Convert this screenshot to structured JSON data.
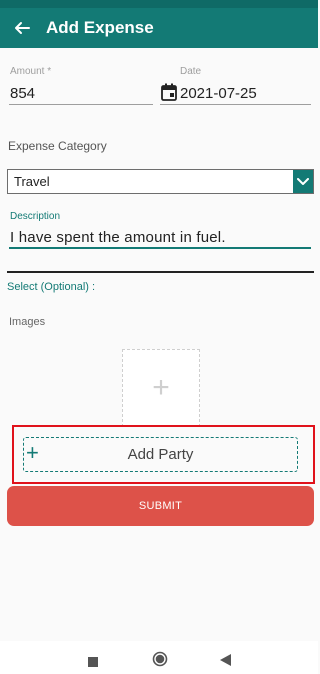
{
  "app_bar": {
    "title": "Add Expense",
    "back_icon": "arrow-left-icon"
  },
  "form": {
    "amount": {
      "label": "Amount *",
      "value": "854"
    },
    "date": {
      "label": "Date",
      "value": "2021-07-25",
      "icon": "calendar-icon"
    },
    "category": {
      "label": "Expense Category",
      "selected": "Travel"
    },
    "description": {
      "label": "Description",
      "value": "I have spent the amount in fuel."
    },
    "select_optional": "Select (Optional) :",
    "images_label": "Images",
    "add_party_label": "Add Party",
    "submit_label": "SUBMIT"
  },
  "colors": {
    "primary": "#137a75",
    "submit": "#dd5249",
    "highlight": "#e0121b"
  },
  "nav": {
    "icons": [
      "recent-apps-icon",
      "home-icon",
      "back-triangle-icon"
    ]
  }
}
